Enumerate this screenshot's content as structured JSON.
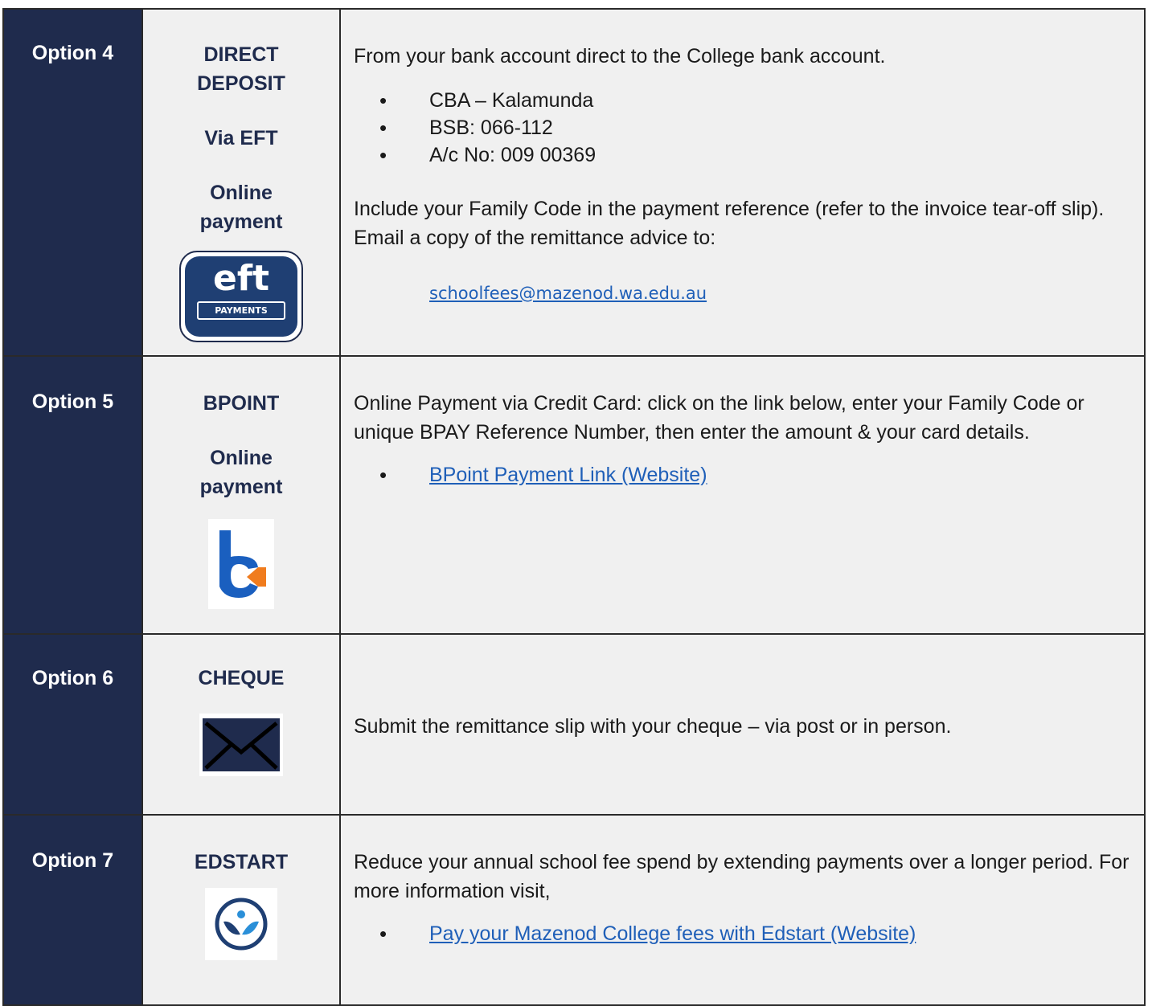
{
  "rows": [
    {
      "option": "Option 4",
      "method_lines": [
        "DIRECT",
        "DEPOSIT",
        "Via EFT",
        "Online",
        "payment"
      ],
      "icon": "eft-payments-icon",
      "icon_text": {
        "word": "eft",
        "tag": "PAYMENTS"
      },
      "intro": "From your bank account direct to the College bank account.",
      "bullets": [
        "CBA – Kalamunda",
        "BSB: 066-112",
        "A/c No: 009 00369"
      ],
      "note": "Include your Family Code in the payment reference (refer to the invoice tear-off slip). Email a copy of the remittance advice to:",
      "email": "schoolfees@mazenod.wa.edu.au"
    },
    {
      "option": "Option 5",
      "method_lines": [
        "BPOINT",
        "Online",
        "payment"
      ],
      "icon": "bpoint-logo-icon",
      "intro": "Online Payment via Credit Card: click on the link below, enter your Family Code or unique BPAY Reference Number, then enter the amount & your card details.",
      "link": "BPoint Payment Link (Website)"
    },
    {
      "option": "Option 6",
      "method_lines": [
        "CHEQUE"
      ],
      "icon": "envelope-icon",
      "intro": "Submit the remittance slip with your cheque – via post or in person."
    },
    {
      "option": "Option 7",
      "method_lines": [
        "EDSTART"
      ],
      "icon": "edstart-logo-icon",
      "intro": "Reduce your annual school fee spend by extending payments over a longer period. For more information visit,",
      "link": "Pay your Mazenod College fees with Edstart (Website)"
    }
  ],
  "colors": {
    "navy": "#1f2b4d",
    "cell_bg": "#f0f0f0",
    "link": "#1f5fb8",
    "bpoint_orange": "#f07c1e",
    "bpoint_blue": "#1a5fbf"
  }
}
